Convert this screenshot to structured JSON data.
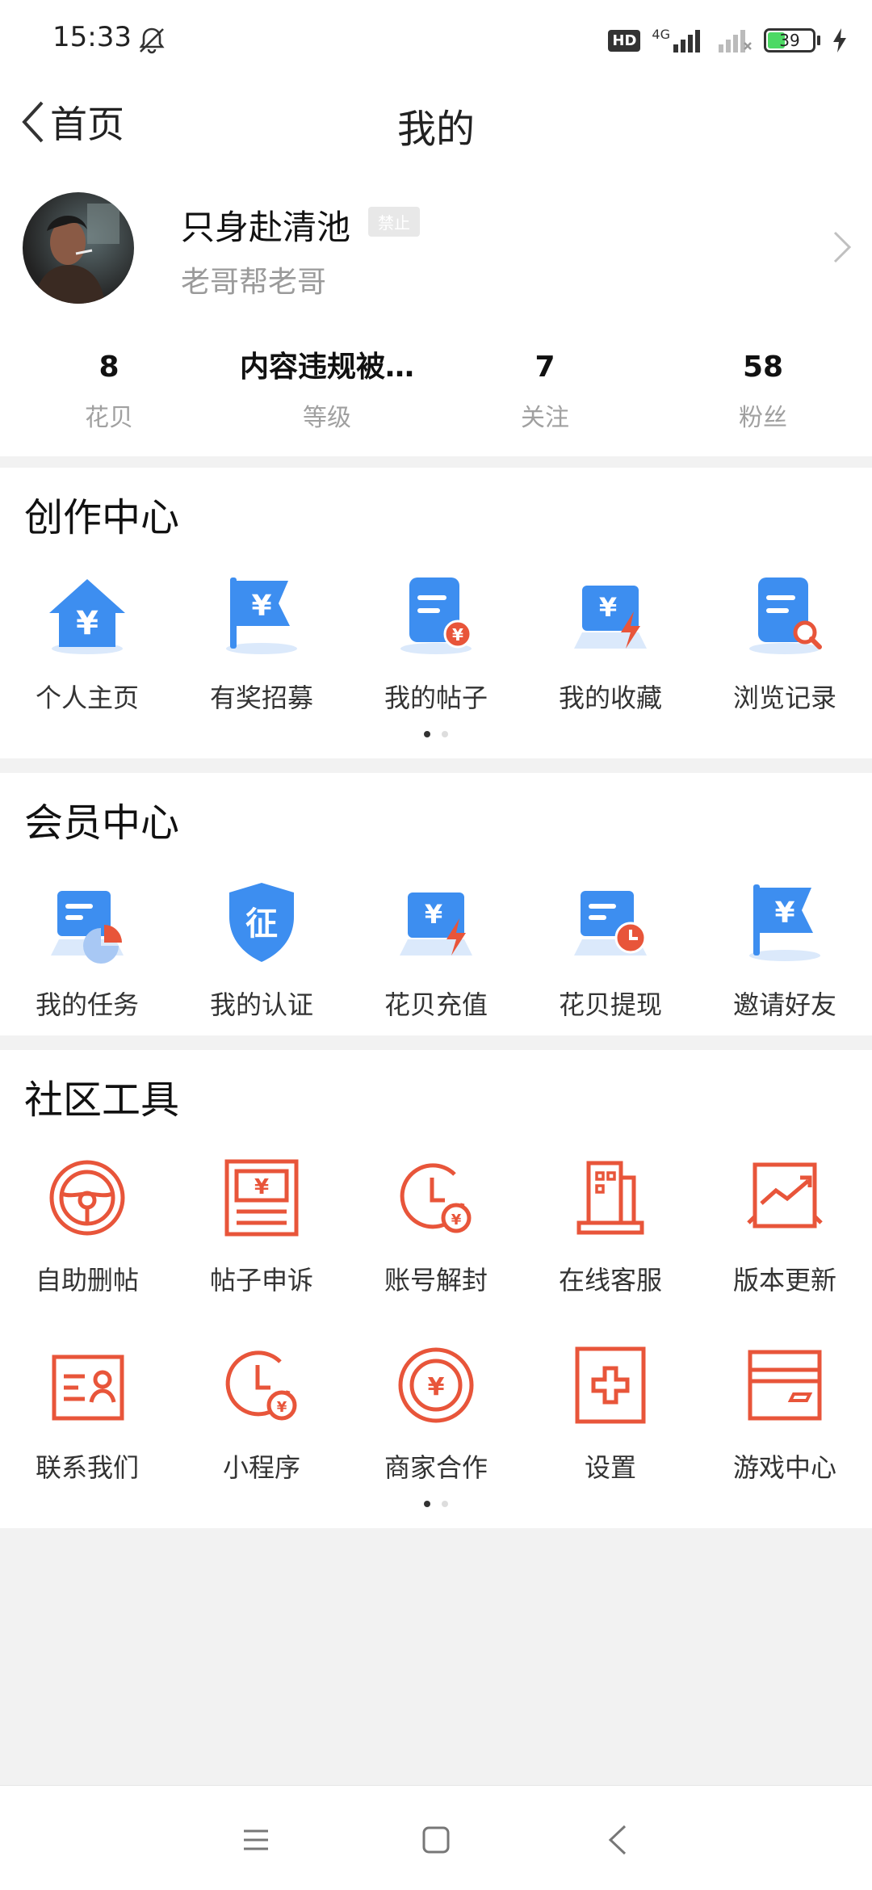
{
  "status": {
    "time": "15:33",
    "hd": "HD",
    "network": "4G",
    "battery_level": 39
  },
  "nav": {
    "back_label": "首页",
    "title": "我的"
  },
  "profile": {
    "username": "只身赴清池",
    "badge": "禁止",
    "subtitle": "老哥帮老哥",
    "stats": [
      {
        "value": "8",
        "label": "花贝"
      },
      {
        "value": "内容违规被…",
        "label": "等级"
      },
      {
        "value": "7",
        "label": "关注"
      },
      {
        "value": "58",
        "label": "粉丝"
      }
    ]
  },
  "creation": {
    "title": "创作中心",
    "items": [
      {
        "label": "个人主页",
        "icon": "home-yuan-icon"
      },
      {
        "label": "有奖招募",
        "icon": "flag-yuan-icon"
      },
      {
        "label": "我的帖子",
        "icon": "clipboard-yuan-icon"
      },
      {
        "label": "我的收藏",
        "icon": "laptop-bolt-icon"
      },
      {
        "label": "浏览记录",
        "icon": "clipboard-search-icon"
      }
    ]
  },
  "member": {
    "title": "会员中心",
    "items": [
      {
        "label": "我的任务",
        "icon": "task-pie-icon"
      },
      {
        "label": "我的认证",
        "icon": "shield-verify-icon"
      },
      {
        "label": "花贝充值",
        "icon": "laptop-bolt-icon"
      },
      {
        "label": "花贝提现",
        "icon": "card-clock-icon"
      },
      {
        "label": "邀请好友",
        "icon": "flag-yuan-icon"
      }
    ]
  },
  "tools": {
    "title": "社区工具",
    "items": [
      {
        "label": "自助删帖",
        "icon": "steering-wheel-icon"
      },
      {
        "label": "帖子申诉",
        "icon": "banknote-icon"
      },
      {
        "label": "账号解封",
        "icon": "clock-yuan-icon"
      },
      {
        "label": "在线客服",
        "icon": "building-icon"
      },
      {
        "label": "版本更新",
        "icon": "chart-trend-icon"
      },
      {
        "label": "联系我们",
        "icon": "contact-card-icon"
      },
      {
        "label": "小程序",
        "icon": "clock-yuan-icon"
      },
      {
        "label": "商家合作",
        "icon": "coin-yuan-icon"
      },
      {
        "label": "设置",
        "icon": "plus-box-icon"
      },
      {
        "label": "游戏中心",
        "icon": "wallet-card-icon"
      }
    ]
  },
  "colors": {
    "blue": "#3d8ef0",
    "orange": "#e8553a",
    "light_blue": "#dbe9fb"
  }
}
